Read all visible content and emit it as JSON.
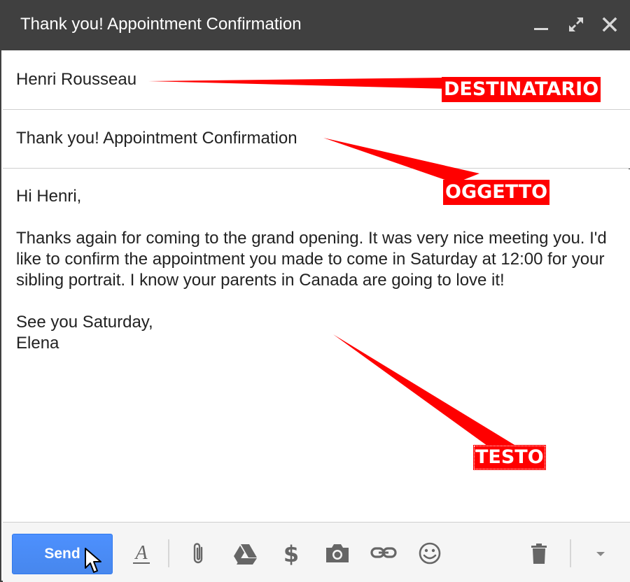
{
  "window": {
    "title": "Thank you! Appointment Confirmation",
    "controls": {
      "minimize": "minimize-icon",
      "expand": "expand-icon",
      "close": "close-icon"
    }
  },
  "compose": {
    "to": "Henri Rousseau",
    "subject": "Thank you! Appointment Confirmation",
    "body": {
      "greeting": "Hi Henri,",
      "paragraph": "Thanks again for coming to the grand opening. It was very nice meeting you. I'd like to confirm the appointment you made to come in Saturday at 12:00 for your sibling portrait. I know your parents in Canada are going to love it!",
      "closing": "See you Saturday,",
      "signature": "Elena"
    }
  },
  "toolbar": {
    "send_label": "Send",
    "icons": [
      "format-text-icon",
      "attach-icon",
      "drive-icon",
      "money-icon",
      "camera-icon",
      "link-icon",
      "emoji-icon",
      "trash-icon",
      "more-options-icon"
    ]
  },
  "annotations": {
    "recipient_label": "DESTINATARIO",
    "subject_label": "OGGETTO",
    "body_label": "TESTO",
    "color": "#ff0000"
  },
  "colors": {
    "titlebar": "#404040",
    "send_button": "#4d90fe",
    "toolbar_bg": "#f5f5f5"
  }
}
